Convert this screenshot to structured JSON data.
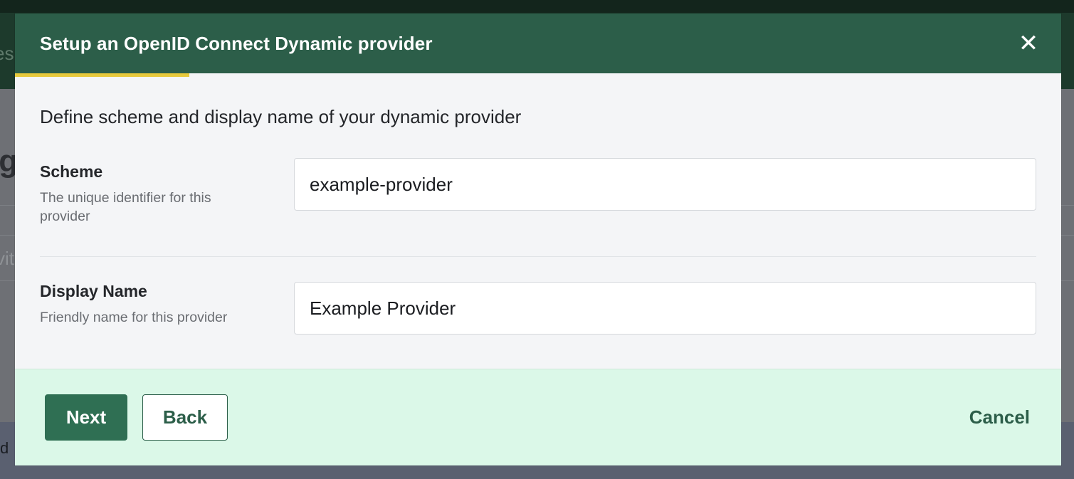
{
  "background": {
    "header_fragment": "es",
    "title_fragment": "lg",
    "search_fragment": "vit",
    "banner_fragment": "d"
  },
  "modal": {
    "title": "Setup an OpenID Connect Dynamic provider",
    "close_icon": "close-icon",
    "progress_fraction": 0.167,
    "intro": "Define scheme and display name of your dynamic provider",
    "fields": {
      "scheme": {
        "label": "Scheme",
        "help": "The unique identifier for this provider",
        "value": "example-provider"
      },
      "display_name": {
        "label": "Display Name",
        "help": "Friendly name for this provider",
        "value": "Example Provider"
      }
    },
    "footer": {
      "next_label": "Next",
      "back_label": "Back",
      "cancel_label": "Cancel"
    }
  },
  "colors": {
    "header_bg": "#2c5e49",
    "progress": "#e7c93c",
    "footer_bg": "#dbf8e8",
    "primary_button": "#2f6f53"
  }
}
